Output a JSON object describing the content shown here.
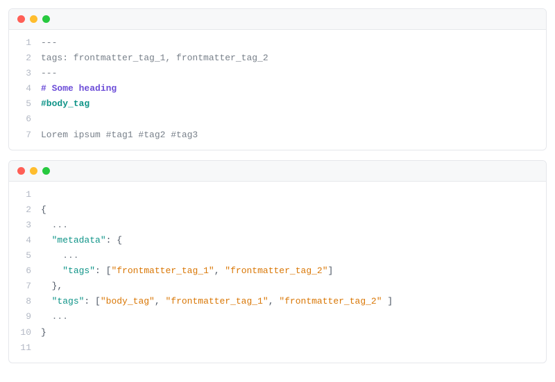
{
  "block1": {
    "lines": [
      {
        "n": "1",
        "tokens": [
          {
            "t": "---",
            "c": "tk-gray"
          }
        ]
      },
      {
        "n": "2",
        "tokens": [
          {
            "t": "tags: frontmatter_tag_1, frontmatter_tag_2",
            "c": "tk-gray"
          }
        ]
      },
      {
        "n": "3",
        "tokens": [
          {
            "t": "---",
            "c": "tk-gray"
          }
        ]
      },
      {
        "n": "4",
        "tokens": [
          {
            "t": "# ",
            "c": "tk-purple"
          },
          {
            "t": "Some heading",
            "c": "tk-purple"
          }
        ]
      },
      {
        "n": "5",
        "tokens": [
          {
            "t": "#body_tag",
            "c": "tk-green"
          }
        ]
      },
      {
        "n": "6",
        "tokens": [
          {
            "t": " ",
            "c": "tk-gray"
          }
        ]
      },
      {
        "n": "7",
        "tokens": [
          {
            "t": "Lorem ipsum #tag1 #tag2 #tag3",
            "c": "tk-gray"
          }
        ]
      }
    ]
  },
  "block2": {
    "lines": [
      {
        "n": "1",
        "tokens": [
          {
            "t": " ",
            "c": "tk-gray"
          }
        ]
      },
      {
        "n": "2",
        "tokens": [
          {
            "t": "{",
            "c": "tk-punc"
          }
        ]
      },
      {
        "n": "3",
        "tokens": [
          {
            "t": "  ...",
            "c": "tk-gray"
          }
        ]
      },
      {
        "n": "4",
        "tokens": [
          {
            "t": "  ",
            "c": "tk-gray"
          },
          {
            "t": "\"metadata\"",
            "c": "tk-key"
          },
          {
            "t": ": ",
            "c": "tk-punc"
          },
          {
            "t": "{",
            "c": "tk-punc"
          }
        ]
      },
      {
        "n": "5",
        "tokens": [
          {
            "t": "    ...",
            "c": "tk-gray"
          }
        ]
      },
      {
        "n": "6",
        "tokens": [
          {
            "t": "    ",
            "c": "tk-gray"
          },
          {
            "t": "\"tags\"",
            "c": "tk-key"
          },
          {
            "t": ": ",
            "c": "tk-punc"
          },
          {
            "t": "[",
            "c": "tk-bracket"
          },
          {
            "t": "\"frontmatter_tag_1\"",
            "c": "tk-str"
          },
          {
            "t": ", ",
            "c": "tk-punc"
          },
          {
            "t": "\"frontmatter_tag_2\"",
            "c": "tk-str"
          },
          {
            "t": "]",
            "c": "tk-bracket"
          }
        ]
      },
      {
        "n": "7",
        "tokens": [
          {
            "t": "  ",
            "c": "tk-gray"
          },
          {
            "t": "},",
            "c": "tk-punc"
          }
        ]
      },
      {
        "n": "8",
        "tokens": [
          {
            "t": "  ",
            "c": "tk-gray"
          },
          {
            "t": "\"tags\"",
            "c": "tk-key"
          },
          {
            "t": ": ",
            "c": "tk-punc"
          },
          {
            "t": "[",
            "c": "tk-bracket"
          },
          {
            "t": "\"body_tag\"",
            "c": "tk-str"
          },
          {
            "t": ", ",
            "c": "tk-punc"
          },
          {
            "t": "\"frontmatter_tag_1\"",
            "c": "tk-str"
          },
          {
            "t": ", ",
            "c": "tk-punc"
          },
          {
            "t": "\"frontmatter_tag_2\"",
            "c": "tk-str"
          },
          {
            "t": " ]",
            "c": "tk-bracket"
          }
        ]
      },
      {
        "n": "9",
        "tokens": [
          {
            "t": "  ...",
            "c": "tk-gray"
          }
        ]
      },
      {
        "n": "10",
        "tokens": [
          {
            "t": "}",
            "c": "tk-punc"
          }
        ]
      },
      {
        "n": "11",
        "tokens": [
          {
            "t": " ",
            "c": "tk-gray"
          }
        ]
      }
    ]
  }
}
